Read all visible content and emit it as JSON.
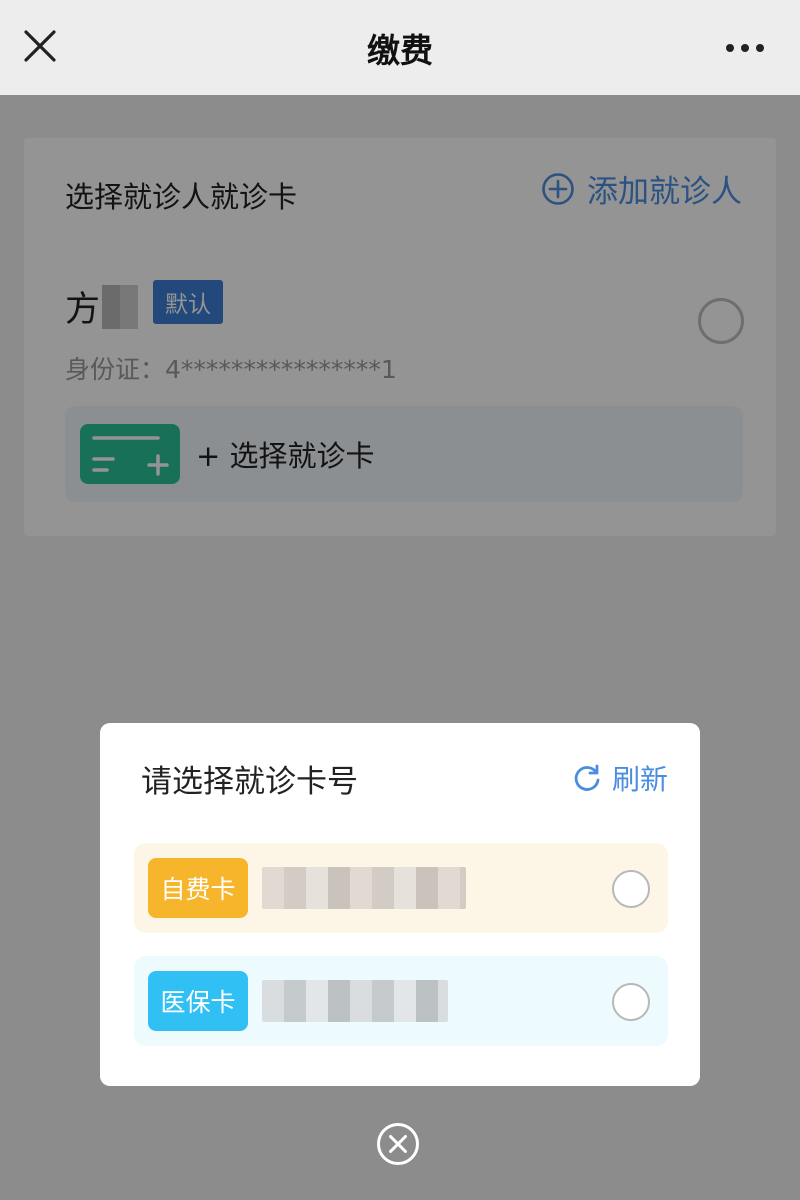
{
  "navbar": {
    "title": "缴费",
    "close_icon": "close-icon",
    "more_icon": "more-icon"
  },
  "card": {
    "title": "选择就诊人就诊卡",
    "add_patient_label": "添加就诊人",
    "patient_name": "方",
    "default_badge": "默认",
    "id_line": "身份证：4****************1",
    "select_card_label": "+ 选择就诊卡"
  },
  "modal": {
    "title": "请选择就诊卡号",
    "refresh_label": "刷新",
    "options": [
      {
        "badge": "自费卡",
        "color": "#f7b52b"
      },
      {
        "badge": "医保卡",
        "color": "#30c0f4"
      }
    ]
  },
  "colors": {
    "accent": "#4a8de0",
    "card_icon": "#2cc299",
    "mask": "rgba(0,0,0,0.42)"
  }
}
